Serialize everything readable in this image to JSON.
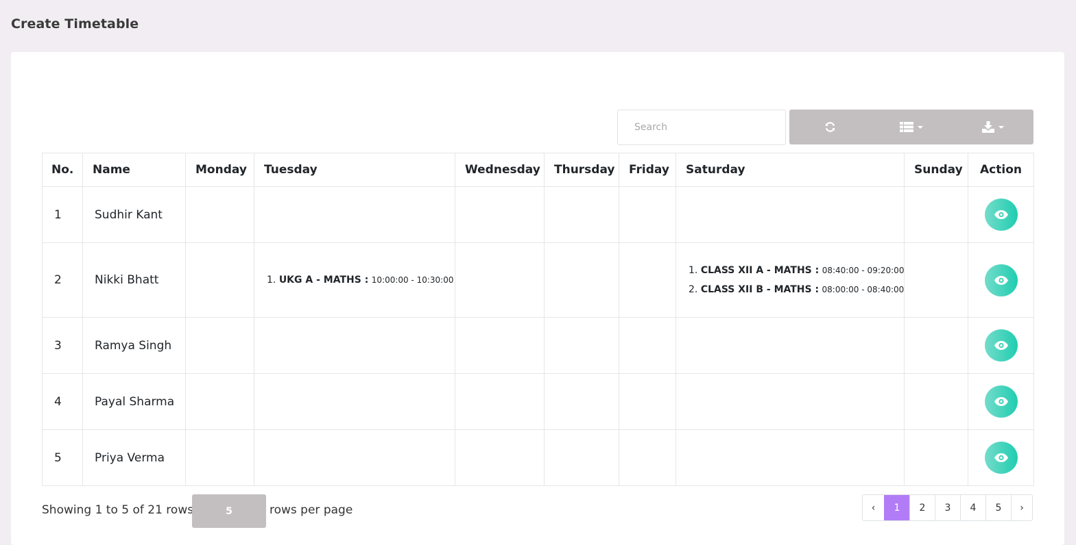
{
  "page": {
    "title": "Create Timetable"
  },
  "toolbar": {
    "search_placeholder": "Search",
    "refresh_icon": "refresh-icon",
    "columns_icon": "columns-list-icon",
    "export_icon": "download-icon"
  },
  "table": {
    "headers": [
      "No.",
      "Name",
      "Monday",
      "Tuesday",
      "Wednesday",
      "Thursday",
      "Friday",
      "Saturday",
      "Sunday",
      "Action"
    ],
    "rows": [
      {
        "no": "1",
        "name": "Sudhir Kant",
        "tuesday": [],
        "saturday": []
      },
      {
        "no": "2",
        "name": "Nikki Bhatt",
        "tuesday": [
          {
            "num": "1.",
            "cls": "UKG A - MATHS :",
            "time": "10:00:00 - 10:30:00"
          }
        ],
        "saturday": [
          {
            "num": "1.",
            "cls": "CLASS XII A - MATHS :",
            "time": "08:40:00 - 09:20:00"
          },
          {
            "num": "2.",
            "cls": "CLASS XII B - MATHS :",
            "time": "08:00:00 - 08:40:00"
          }
        ]
      },
      {
        "no": "3",
        "name": "Ramya Singh",
        "tuesday": [],
        "saturday": []
      },
      {
        "no": "4",
        "name": "Payal Sharma",
        "tuesday": [],
        "saturday": []
      },
      {
        "no": "5",
        "name": "Priya Verma",
        "tuesday": [],
        "saturday": []
      }
    ],
    "action_icon": "eye-icon"
  },
  "footer": {
    "showing_text": "Showing 1 to 5 of 21 rows",
    "page_size": "5",
    "rows_per_page_label": "rows per page",
    "pagination": {
      "prev": "‹",
      "pages": [
        "1",
        "2",
        "3",
        "4",
        "5"
      ],
      "active": "1",
      "next": "›"
    }
  },
  "colors": {
    "background": "#f1edf2",
    "toolbar_button": "#c3bfc0",
    "action_button": "#1fcdb0",
    "active_page": "#b27cf7"
  }
}
